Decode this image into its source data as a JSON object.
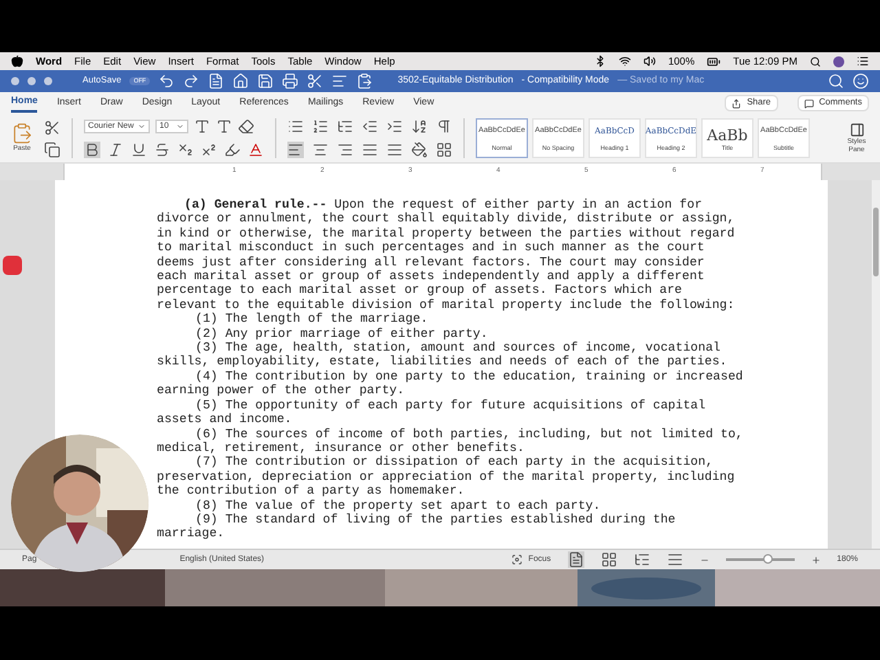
{
  "menu_bar": {
    "app": "Word",
    "items": [
      "File",
      "Edit",
      "View",
      "Insert",
      "Format",
      "Tools",
      "Table",
      "Window",
      "Help"
    ],
    "battery": "100%",
    "clock": "Tue 12:09 PM"
  },
  "title_bar": {
    "autosave": "AutoSave",
    "autosave_toggle": {
      "label": "OFF",
      "on": false
    },
    "document": "3502-Equitable Distribution",
    "mode": "- Compatibility Mode",
    "saved": "— Saved to my Mac"
  },
  "tabs": [
    {
      "label": "Home",
      "selected": true
    },
    {
      "label": "Insert",
      "selected": false
    },
    {
      "label": "Draw",
      "selected": false
    },
    {
      "label": "Design",
      "selected": false
    },
    {
      "label": "Layout",
      "selected": false
    },
    {
      "label": "References",
      "selected": false
    },
    {
      "label": "Mailings",
      "selected": false
    },
    {
      "label": "Review",
      "selected": false
    },
    {
      "label": "View",
      "selected": false
    }
  ],
  "share": "Share",
  "comments": "Comments",
  "ribbon": {
    "paste": "Paste",
    "font": "Courier New",
    "size": "10",
    "styles": [
      {
        "preview": "AaBbCcDdEe",
        "name": "Normal",
        "selected": true,
        "kind": "small"
      },
      {
        "preview": "AaBbCcDdEe",
        "name": "No Spacing",
        "selected": false,
        "kind": "small"
      },
      {
        "preview": "AaBbCcD",
        "name": "Heading 1",
        "selected": false,
        "kind": "heading"
      },
      {
        "preview": "AaBbCcDdE",
        "name": "Heading 2",
        "selected": false,
        "kind": "heading"
      },
      {
        "preview": "AaBb",
        "name": "Title",
        "selected": false,
        "kind": "title"
      },
      {
        "preview": "AaBbCcDdEe",
        "name": "Subtitle",
        "selected": false,
        "kind": "small"
      }
    ],
    "styles_pane": "Styles Pane"
  },
  "ruler": [
    "1",
    "2",
    "3",
    "4",
    "5",
    "6",
    "7"
  ],
  "document": {
    "paragraphs": [
      {
        "lines": [
          "**(a) General rule.--** Upon the request of either party in an action for",
          "divorce or annulment, the court shall equitably divide, distribute or assign,",
          "in kind or otherwise, the marital property between the parties without regard",
          "to marital misconduct in such percentages and in such manner as the court",
          "deems just after considering all relevant factors. The court may consider",
          "each marital asset or group of assets independently and apply a different",
          "percentage to each marital asset or group of assets. Factors which are",
          "relevant to the equitable division of marital property include the following:"
        ],
        "kind": "outer"
      },
      {
        "lines": [
          "(1) The length of the marriage."
        ],
        "kind": "item"
      },
      {
        "lines": [
          "(2) Any prior marriage of either party."
        ],
        "kind": "item"
      },
      {
        "lines": [
          "(3) The age, health, station, amount and sources of income, vocational",
          "skills, employability, estate, liabilities and needs of each of the parties."
        ],
        "kind": "item"
      },
      {
        "lines": [
          "(4) The contribution by one party to the education, training or increased",
          "earning power of the other party."
        ],
        "kind": "item"
      },
      {
        "lines": [
          "(5) The opportunity of each party for future acquisitions of capital",
          "assets and income."
        ],
        "kind": "item"
      },
      {
        "lines": [
          "(6) The sources of income of both parties, including, but not limited to,",
          "medical, retirement, insurance or other benefits."
        ],
        "kind": "item"
      },
      {
        "lines": [
          "(7) The contribution or dissipation of each party in the acquisition,",
          "preservation, depreciation or appreciation of the marital property, including",
          "the contribution of a party as homemaker."
        ],
        "kind": "item"
      },
      {
        "lines": [
          "(8) The value of the property set apart to each party."
        ],
        "kind": "item"
      },
      {
        "lines": [
          "(9) The standard of living of the parties established during the",
          "marriage."
        ],
        "kind": "item"
      }
    ]
  },
  "status_bar": {
    "page": "Pag",
    "language": "English (United States)",
    "focus": "Focus",
    "zoom": {
      "level": 0.6
    },
    "zoom_text": "180%"
  },
  "webcam": {
    "kind": "picture"
  }
}
